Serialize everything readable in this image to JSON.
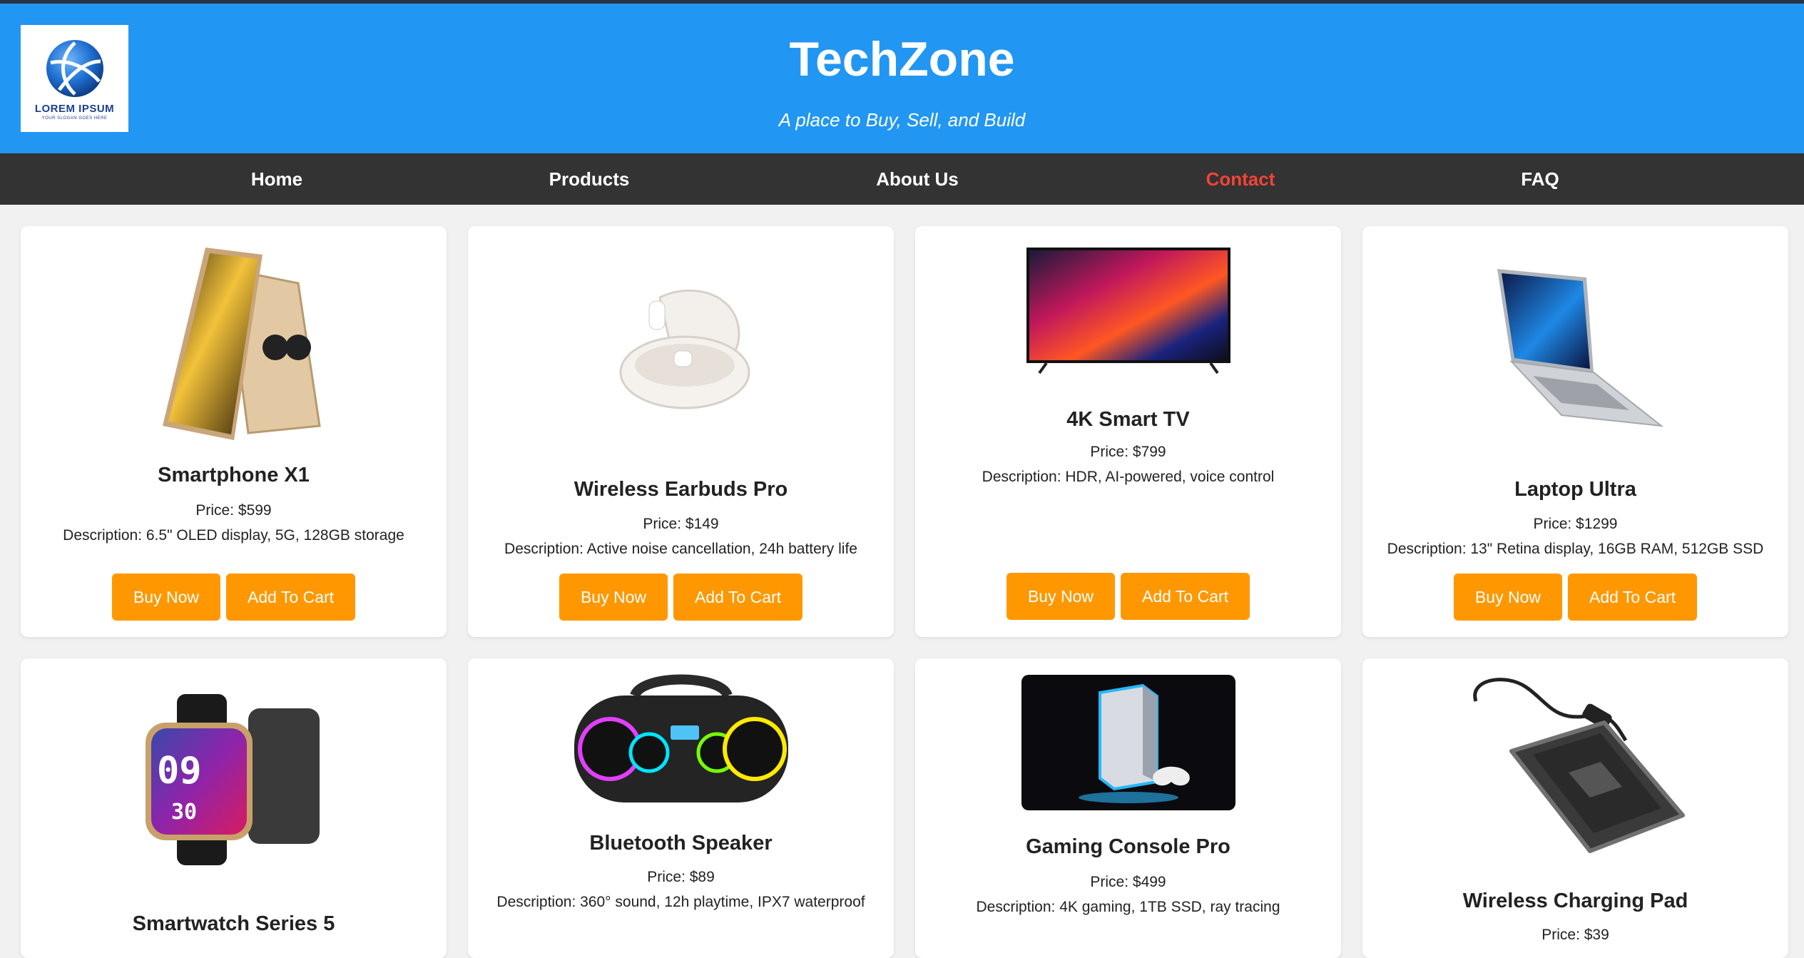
{
  "header": {
    "logo_text": "LOREM IPSUM",
    "logo_slogan": "YOUR SLOGAN GOES HERE",
    "title": "TechZone",
    "tagline": "A place to Buy, Sell, and Build"
  },
  "nav": {
    "items": [
      {
        "label": "Home"
      },
      {
        "label": "Products"
      },
      {
        "label": "About Us"
      },
      {
        "label": "Contact",
        "active": true
      },
      {
        "label": "FAQ"
      }
    ]
  },
  "products": [
    {
      "name": "Smartphone X1",
      "price": "Price: $599",
      "description": "Description: 6.5\" OLED display, 5G, 128GB storage",
      "buy_label": "Buy Now",
      "cart_label": "Add To Cart"
    },
    {
      "name": "Wireless Earbuds Pro",
      "price": "Price: $149",
      "description": "Description: Active noise cancellation, 24h battery life",
      "buy_label": "Buy Now",
      "cart_label": "Add To Cart"
    },
    {
      "name": "4K Smart TV",
      "price": "Price: $799",
      "description": "Description: HDR, AI-powered, voice control",
      "buy_label": "Buy Now",
      "cart_label": "Add To Cart"
    },
    {
      "name": "Laptop Ultra",
      "price": "Price: $1299",
      "description": "Description: 13\" Retina display, 16GB RAM, 512GB SSD",
      "buy_label": "Buy Now",
      "cart_label": "Add To Cart"
    },
    {
      "name": "Smartwatch Series 5",
      "watch_time_h": "09",
      "watch_time_m": "30"
    },
    {
      "name": "Bluetooth Speaker",
      "price": "Price: $89",
      "description": "Description: 360° sound, 12h playtime, IPX7 waterproof"
    },
    {
      "name": "Gaming Console Pro",
      "price": "Price: $499",
      "description": "Description: 4K gaming, 1TB SSD, ray tracing"
    },
    {
      "name": "Wireless Charging Pad",
      "price": "Price: $39"
    }
  ],
  "colors": {
    "header_bg": "#2196f3",
    "nav_bg": "#333333",
    "nav_active": "#f44336",
    "button_bg": "#ff9800"
  }
}
